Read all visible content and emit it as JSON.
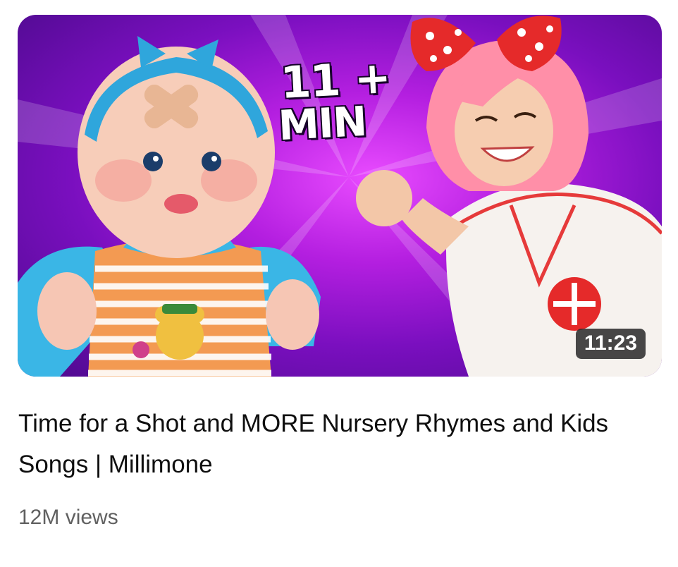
{
  "video": {
    "thumbnail_overlay_top": "11 +",
    "thumbnail_overlay_bottom": "MIN",
    "duration": "11:23",
    "title": "Time for a Shot and MORE Nursery Rhymes and Kids Songs | Millimone",
    "views": "12M views"
  },
  "colors": {
    "thumbnail_background": "#b41fe0",
    "title_text": "#0f0f0f",
    "meta_text": "#606060",
    "duration_badge": "#282828"
  }
}
